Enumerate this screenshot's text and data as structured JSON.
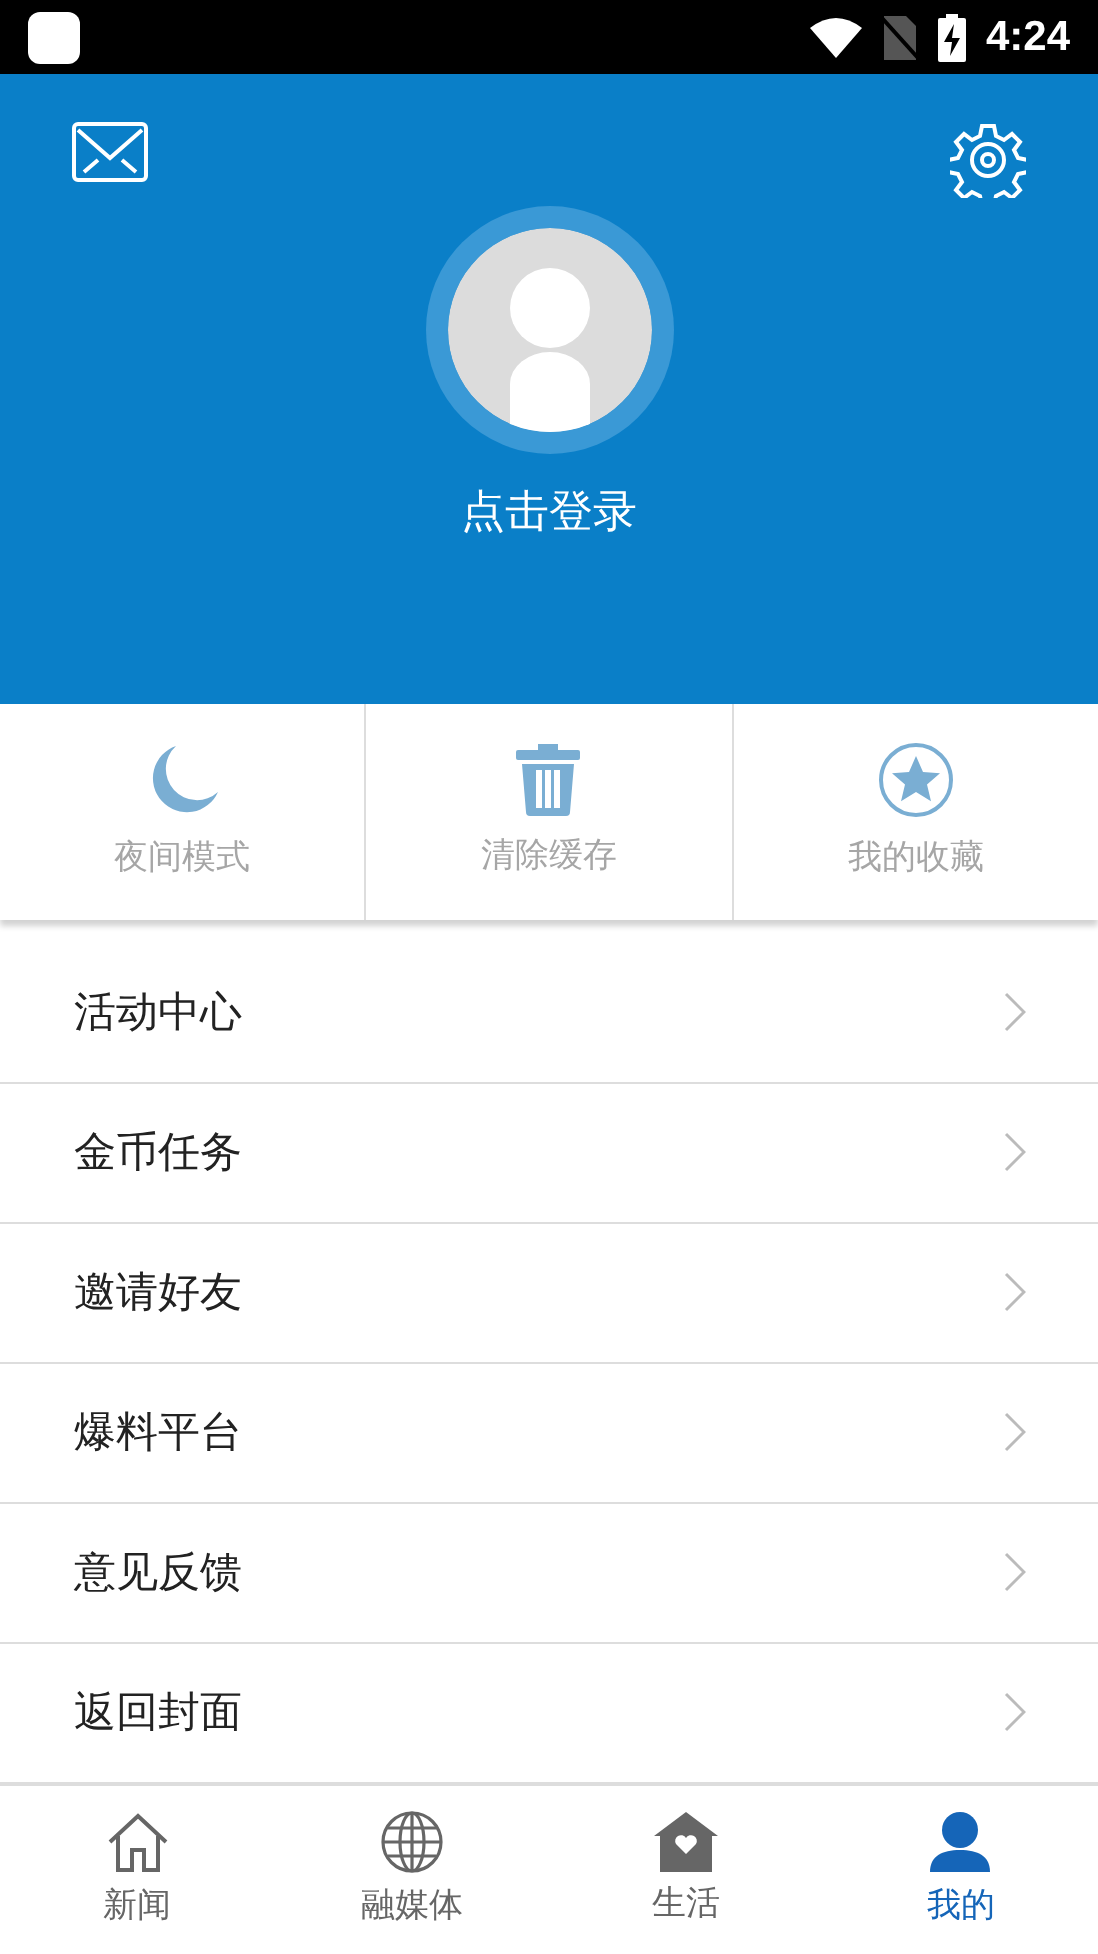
{
  "status_bar": {
    "time": "4:24"
  },
  "profile": {
    "login_label": "点击登录"
  },
  "quick_actions": [
    {
      "kind": "moon",
      "label": "夜间模式"
    },
    {
      "kind": "trash",
      "label": "清除缓存"
    },
    {
      "kind": "star",
      "label": "我的收藏"
    }
  ],
  "menu": [
    "活动中心",
    "金币任务",
    "邀请好友",
    "爆料平台",
    "意见反馈",
    "返回封面"
  ],
  "tab_bar": [
    {
      "kind": "home",
      "label": "新闻",
      "selected": false
    },
    {
      "kind": "globe",
      "label": "融媒体",
      "selected": false
    },
    {
      "kind": "house-heart",
      "label": "生活",
      "selected": false
    },
    {
      "kind": "person",
      "label": "我的",
      "selected": true
    }
  ]
}
